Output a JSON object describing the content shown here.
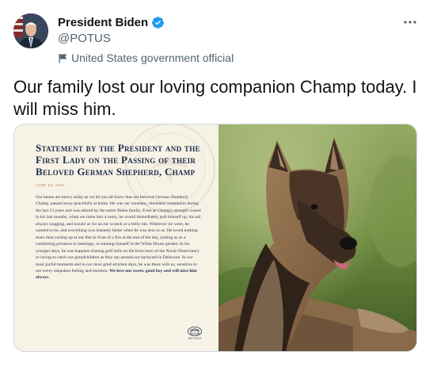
{
  "user": {
    "name": "President Biden",
    "handle": "@POTUS",
    "label": "United States government official"
  },
  "tweet": {
    "text": "Our family lost our loving companion Champ today. I will miss him."
  },
  "statement": {
    "title": "Statement by the President and the First Lady on the Passing of their Beloved German Shepherd, Champ",
    "date": "JUNE 19, 2021",
    "body": "Our hearts are heavy today as we let you all know that our beloved German Shepherd, Champ, passed away peacefully at home. He was our constant, cherished companion during the last 13 years and was adored by the entire Biden family. Even as Champ's strength waned in his last months, when we came into a room, he would immediately pull himself up, his tail always wagging, and nuzzle us for an ear scratch or a belly rub. Wherever we were, he wanted to be, and everything was instantly better when he was next to us. He loved nothing more than curling up at our feet in front of a fire at the end of the day, joining us as a comforting presence in meetings, or sunning himself in the White House garden. In his younger days, he was happiest chasing golf balls on the front lawn of the Naval Observatory or racing to catch our grandchildren as they ran around our backyard in Delaware. In our most joyful moments and in our most grief-stricken days, he was there with us, sensitive to our every unspoken feeling and emotion.",
    "closing": "We love our sweet, good boy and will miss him always.",
    "footer": "WH.GOV"
  },
  "icons": {
    "verified": "verified-badge-icon",
    "label": "government-flag-icon",
    "more": "more-dots-icon"
  },
  "colors": {
    "verified": "#1d9bf0",
    "secondary_text": "#536471",
    "statement_title": "#1c2c4a",
    "statement_bg": "#f6f2e6"
  }
}
